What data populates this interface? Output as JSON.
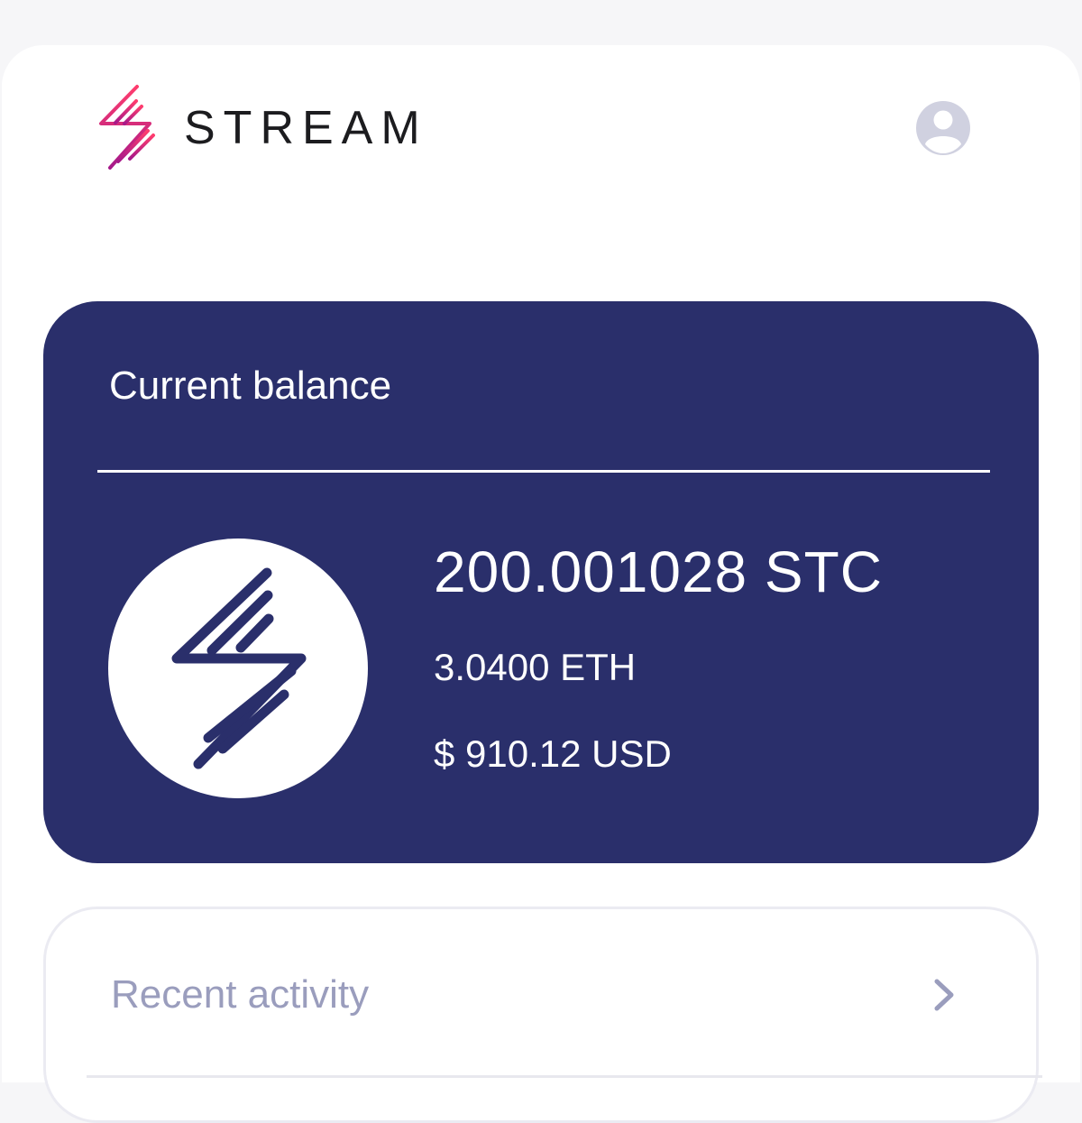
{
  "header": {
    "brand_name": "STREAM",
    "logo_icon": "stream-bolt-logo",
    "profile_icon": "user-avatar-icon"
  },
  "balance": {
    "title": "Current balance",
    "token_icon": "stream-token-icon",
    "amount_stc": "200.001028 STC",
    "amount_eth": "3.0400 ETH",
    "amount_usd": "$ 910.12 USD"
  },
  "activity": {
    "title": "Recent activity",
    "chevron_icon": "chevron-right-icon"
  },
  "colors": {
    "card_background": "#2a2f6b",
    "brand_gradient_start": "#ff3d6e",
    "brand_gradient_end": "#a6198a",
    "muted_text": "#9a9dbd",
    "icon_gray": "#d0d1e0"
  }
}
